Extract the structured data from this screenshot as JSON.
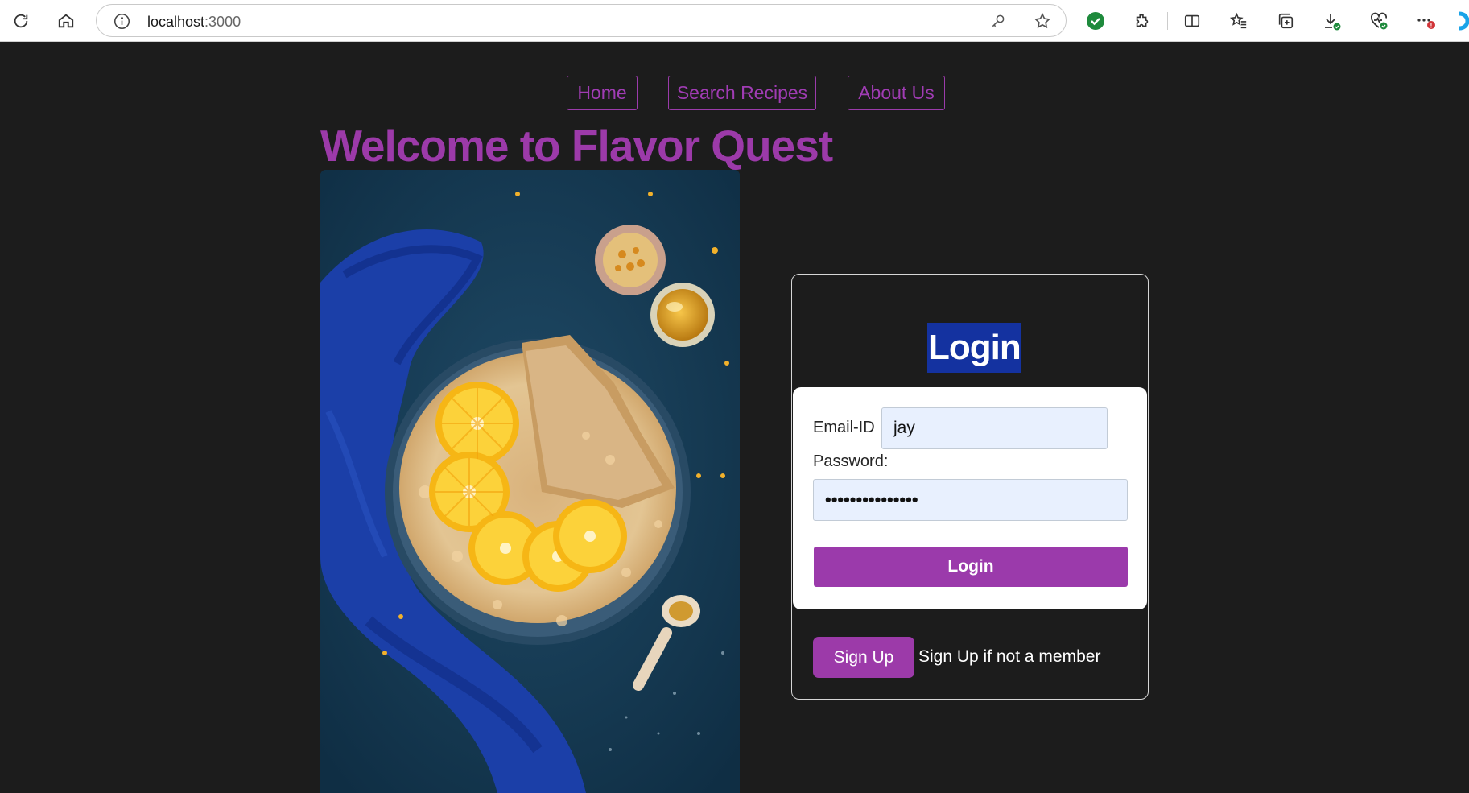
{
  "browser": {
    "url_host": "localhost",
    "url_port": ":3000"
  },
  "nav": {
    "home": "Home",
    "search": "Search Recipes",
    "about": "About Us"
  },
  "heading": "Welcome to Flavor Quest",
  "login": {
    "title": "Login",
    "email_label": "Email-ID :",
    "email_value": "jay",
    "password_label": "Password:",
    "password_value": "•••••••••••••••",
    "submit_label": "Login",
    "signup_label": "Sign Up",
    "signup_note": "Sign Up if not a member"
  },
  "colors": {
    "accent": "#9c3aa9",
    "title_bg": "#1432a0",
    "page_bg": "#1c1c1c"
  }
}
